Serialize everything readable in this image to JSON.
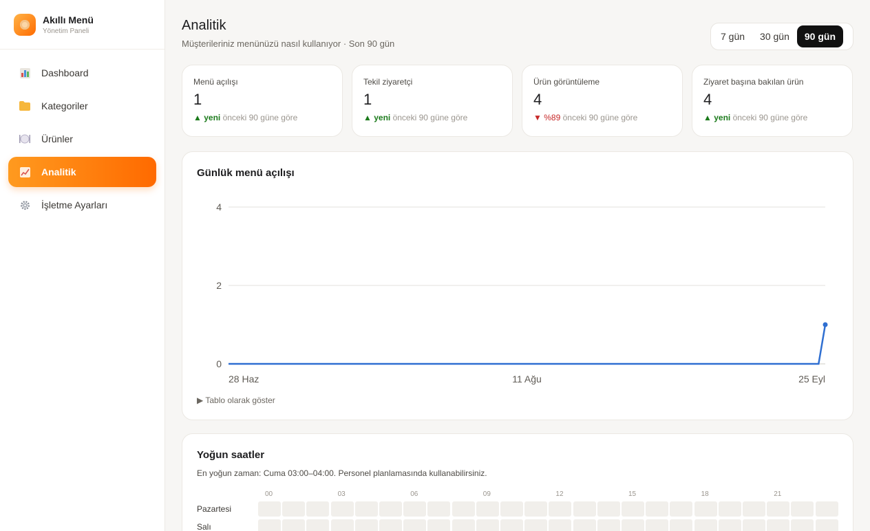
{
  "brand": {
    "title": "Akıllı Menü",
    "subtitle": "Yönetim Paneli"
  },
  "nav": [
    {
      "label": "Dashboard",
      "icon": "bar-chart-icon",
      "active": false
    },
    {
      "label": "Kategoriler",
      "icon": "folder-icon",
      "active": false
    },
    {
      "label": "Ürünler",
      "icon": "plate-icon",
      "active": false
    },
    {
      "label": "Analitik",
      "icon": "line-chart-icon",
      "active": true
    },
    {
      "label": "İşletme Ayarları",
      "icon": "gear-icon",
      "active": false
    }
  ],
  "header": {
    "title": "Analitik",
    "subtitle": "Müşterileriniz menünüzü nasıl kullanıyor · Son 90 gün"
  },
  "range": {
    "options": [
      "7 gün",
      "30 gün",
      "90 gün"
    ],
    "selected": "90 gün"
  },
  "kpis": [
    {
      "label": "Menü açılışı",
      "value": "1",
      "trend_direction": "up",
      "trend_text": "yeni",
      "trend_suffix": "önceki 90 güne göre"
    },
    {
      "label": "Tekil ziyaretçi",
      "value": "1",
      "trend_direction": "up",
      "trend_text": "yeni",
      "trend_suffix": "önceki 90 güne göre"
    },
    {
      "label": "Ürün görüntüleme",
      "value": "4",
      "trend_direction": "down",
      "trend_text": "%89",
      "trend_suffix": "önceki 90 güne göre"
    },
    {
      "label": "Ziyaret başına bakılan ürün",
      "value": "4",
      "trend_direction": "up",
      "trend_text": "yeni",
      "trend_suffix": "önceki 90 güne göre"
    }
  ],
  "daily_chart": {
    "title": "Günlük menü açılışı",
    "table_toggle": "Tablo olarak göster",
    "line_color": "#2f6fd1"
  },
  "chart_data": {
    "type": "line",
    "title": "Günlük menü açılışı",
    "xlabel": "",
    "ylabel": "",
    "x_ticks": [
      "28 Haz",
      "11 Ağu",
      "25 Eyl"
    ],
    "y_ticks": [
      0,
      2,
      4
    ],
    "ylim": [
      0,
      4
    ],
    "days": 90,
    "series": [
      {
        "values": [
          0,
          0,
          0,
          0,
          0,
          0,
          0,
          0,
          0,
          0,
          0,
          0,
          0,
          0,
          0,
          0,
          0,
          0,
          0,
          0,
          0,
          0,
          0,
          0,
          0,
          0,
          0,
          0,
          0,
          0,
          0,
          0,
          0,
          0,
          0,
          0,
          0,
          0,
          0,
          0,
          0,
          0,
          0,
          0,
          0,
          0,
          0,
          0,
          0,
          0,
          0,
          0,
          0,
          0,
          0,
          0,
          0,
          0,
          0,
          0,
          0,
          0,
          0,
          0,
          0,
          0,
          0,
          0,
          0,
          0,
          0,
          0,
          0,
          0,
          0,
          0,
          0,
          0,
          0,
          0,
          0,
          0,
          0,
          0,
          0,
          0,
          0,
          0,
          0,
          1
        ]
      }
    ],
    "grid": true,
    "legend": "none"
  },
  "heatmap": {
    "title": "Yoğun saatler",
    "subtitle": "En yoğun zaman: Cuma 03:00–04:00. Personel planlamasında kullanabilirsiniz.",
    "hour_labels": [
      "00",
      "03",
      "06",
      "09",
      "12",
      "15",
      "18",
      "21"
    ],
    "days": [
      "Pazartesi",
      "Salı"
    ],
    "cell_color": "#f1efeb"
  }
}
